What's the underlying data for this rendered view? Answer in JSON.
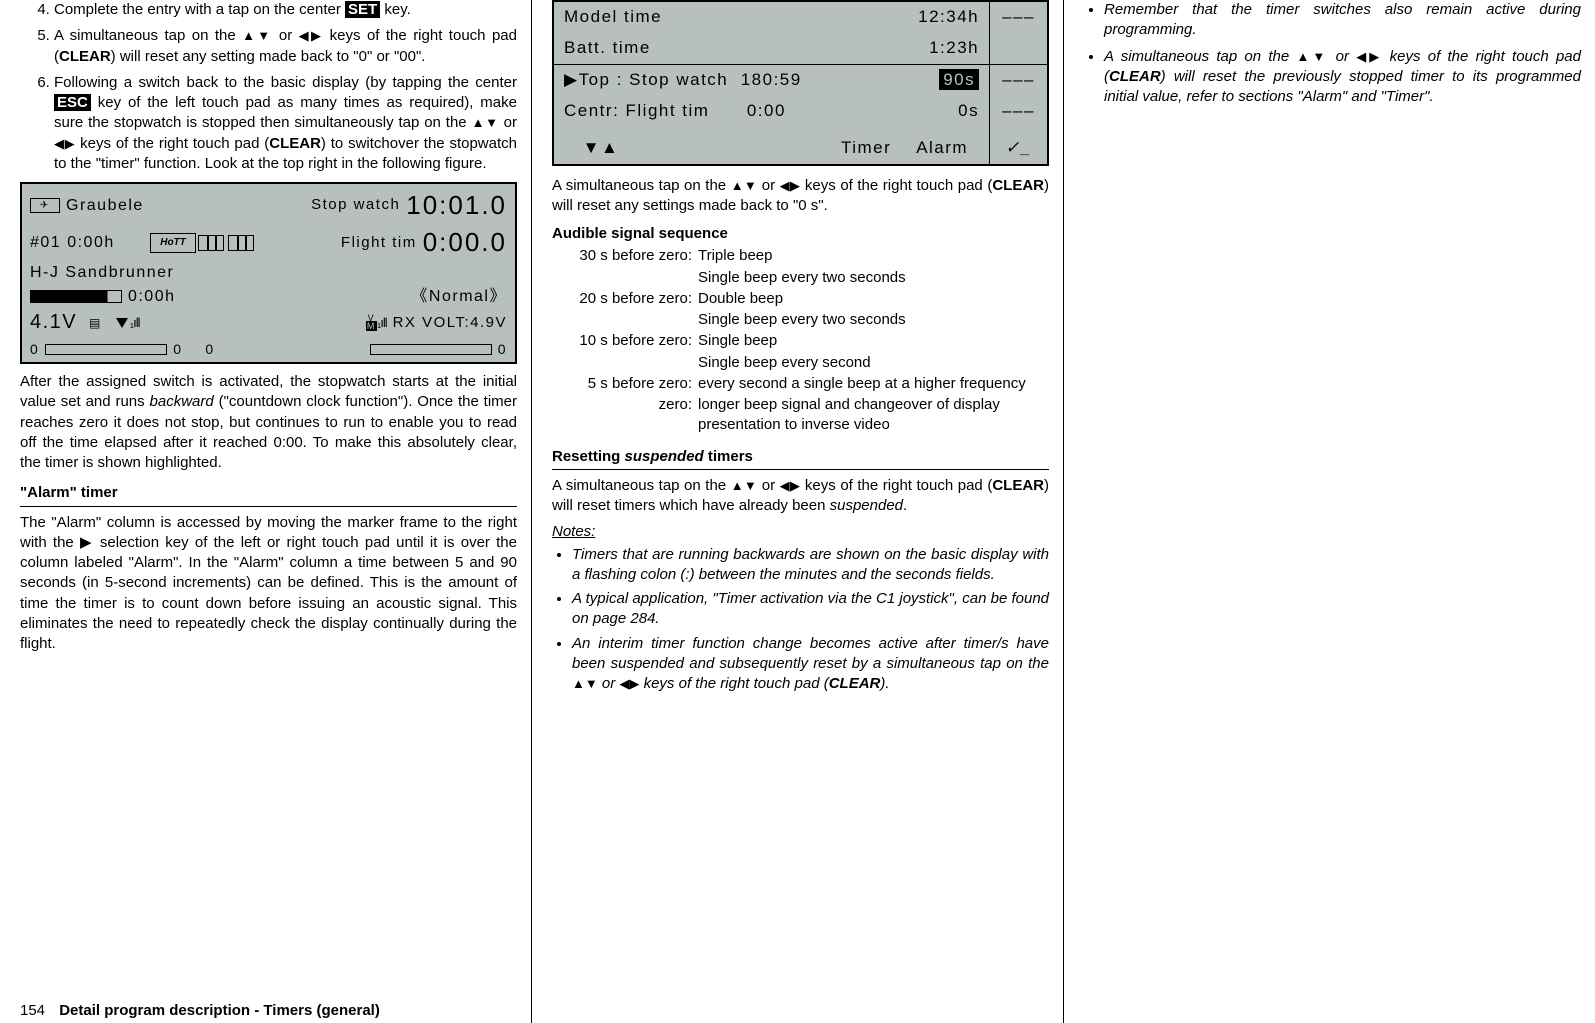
{
  "col1": {
    "step4": "Complete the entry with a tap on the center ",
    "step4_key": "SET",
    "step4_end": " key.",
    "step5a": "A simultaneous tap on the ",
    "step5b": " or ",
    "step5c": " keys of the right touch pad (",
    "step5_clear": "CLEAR",
    "step5d": ") will reset any setting made back to \"0\" or \"00\".",
    "step6a": "Following a switch back to the basic display (by tapping the center ",
    "step6_esc": "ESC",
    "step6b": " key of the left touch pad as many times as required), make sure the stopwatch is stopped then simultaneously tap on the ",
    "step6c": " or ",
    "step6d": " keys of the right touch pad (",
    "step6_clear": "CLEAR",
    "step6e": ") to switchover the stopwatch to the \"timer\" function. Look at the top right in the following figure.",
    "lcd": {
      "model": "Graubele",
      "stop_label": "Stop watch",
      "stop_val": "10:01.0",
      "id": "#01",
      "h1": "0:00h",
      "flight_label": "Flight tim",
      "flight_val": "0:00.0",
      "owner": "H-J Sandbrunner",
      "h2": "0:00h",
      "normal": "Normal",
      "volt1": "4.1V",
      "rxvolt": "RX VOLT:4.9V",
      "zero": "0",
      "vm": "V\nM"
    },
    "para1": "After the assigned switch is activated, the stopwatch starts at the initial value set and runs ",
    "para1_i": "backward",
    "para1b": " (\"countdown clock function\"). Once the timer reaches zero it does not stop, but continues to run to enable you to read off the time elapsed after it reached 0:00. To make this absolutely clear, the timer is shown highlighted.",
    "hdr_alarm": "\"Alarm\" timer",
    "para2": "The \"Alarm\" column is accessed by moving the marker frame to the right with the ▶ selection key of the left or right touch pad until it is over the column labeled \"Alarm\". In the \"Alarm\" column a time between 5 and 90 seconds (in 5-second increments) can be defined. This is the amount of time the timer is to count down before issuing an acoustic signal. This eliminates the need to repeatedly check the display continually during the flight."
  },
  "col2": {
    "lcd": {
      "r1a": "Model time",
      "r1b": "12:34h",
      "r1c": "–––",
      "r2a": "Batt.   time",
      "r2b": "1:23h",
      "r3a": "▶Top  : Stop watch",
      "r3b": "180:59",
      "r3c": "90s",
      "r3d": "–––",
      "r4a": "  Centr: Flight tim",
      "r4b": "0:00",
      "r4c": "0s",
      "r4d": "–––",
      "f1": "▼▲",
      "f2": "Timer",
      "f3": "Alarm",
      "f4": "✓_"
    },
    "para1a": "A simultaneous tap on the ",
    "para1b": " or ",
    "para1c": " keys of the right touch pad (",
    "para1_clear": "CLEAR",
    "para1d": ") will reset any settings made back to \"0 s\".",
    "hdr_audible": "Audible signal sequence",
    "audible": [
      [
        "30 s before zero:",
        "Triple beep"
      ],
      [
        "",
        "Single beep every two seconds"
      ],
      [
        "20 s before zero:",
        "Double beep"
      ],
      [
        "",
        "Single beep every two seconds"
      ],
      [
        "10 s before zero:",
        "Single beep"
      ],
      [
        "",
        "Single beep every second"
      ],
      [
        "5 s before zero:",
        "every second a single beep at a higher frequency"
      ],
      [
        "zero:",
        "longer beep signal and changeover of display presentation to inverse video"
      ]
    ],
    "hdr_reset_a": "Resetting ",
    "hdr_reset_b": "suspended",
    "hdr_reset_c": " timers",
    "para2a": "A simultaneous tap on the ",
    "para2b": " or ",
    "para2c": " keys of the right touch pad (",
    "para2_clear": "CLEAR",
    "para2d": ") will reset timers which have already been ",
    "para2_susp": "suspended",
    "para2e": ".",
    "notes_hdr": "Notes:",
    "n1": "Timers that are running backwards are shown on the basic display with a flashing colon (:) between the minutes and the seconds fields.",
    "n2": "A typical application, \"Timer activation via the C1 joystick\", can be found on page 284.",
    "n3a": "An interim timer function change becomes active after timer/s have been suspended and subsequently reset by a simultaneous tap on the ",
    "n3b": " or ",
    "n3c": " keys of the right touch pad (",
    "n3_clear": "CLEAR",
    "n3d": ")."
  },
  "col3": {
    "n1": "Remember that the timer switches also remain active during programming.",
    "n2a": "A simultaneous tap on the ",
    "n2b": " or ",
    "n2c": " keys of the right touch pad (",
    "n2_clear": "CLEAR",
    "n2d": ") will reset the previously stopped timer to its programmed initial value, refer to sections \"Alarm\" and \"Timer\"."
  },
  "footer": {
    "page": "154",
    "title": "Detail program description - Timers (general)"
  },
  "sym": {
    "ud": "▲▼",
    "lr": "◀▶"
  }
}
